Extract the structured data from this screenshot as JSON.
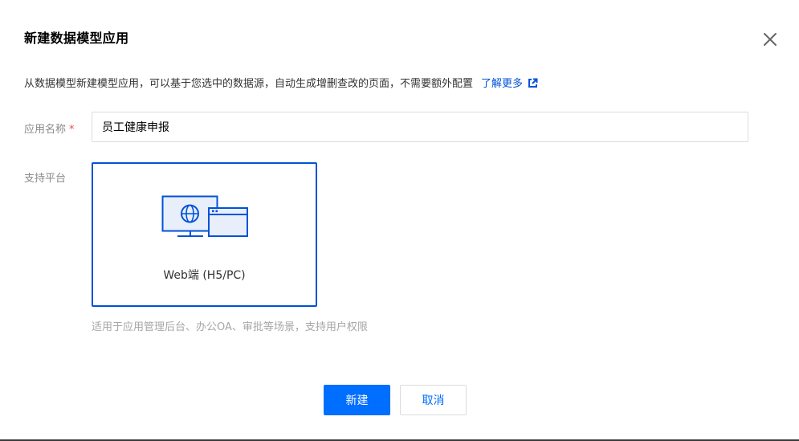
{
  "dialog": {
    "title": "新建数据模型应用",
    "description": "从数据模型新建模型应用，可以基于您选中的数据源，自动生成增删查改的页面，不需要额外配置",
    "learn_more": "了解更多",
    "close_icon": "close-icon",
    "external_link_icon": "external-link-icon"
  },
  "form": {
    "app_name": {
      "label": "应用名称",
      "required_mark": "*",
      "value": "员工健康申报"
    },
    "platform": {
      "label": "支持平台",
      "option_label": "Web端 (H5/PC)",
      "option_icon": "web-desktop-icon",
      "selected": true,
      "hint": "适用于应用管理后台、办公OA、审批等场景，支持用户权限"
    }
  },
  "footer": {
    "confirm_label": "新建",
    "cancel_label": "取消"
  },
  "colors": {
    "accent": "#0052d9",
    "primary_button": "#006eff",
    "required": "#e34d59"
  }
}
